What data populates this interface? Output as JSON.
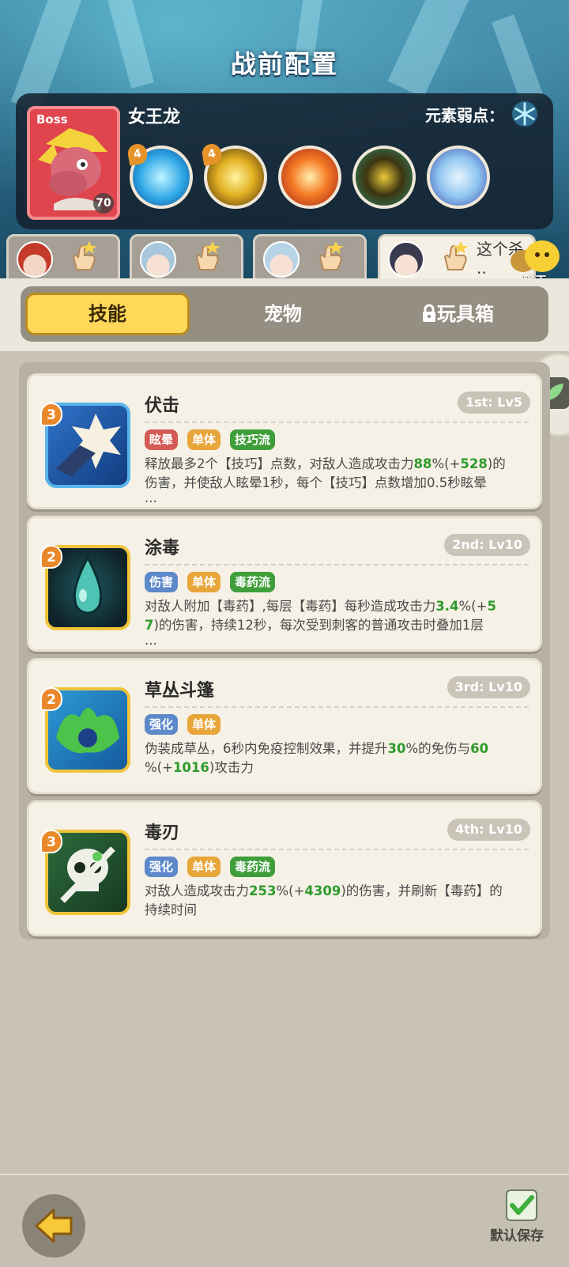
{
  "header": {
    "title": "战前配置"
  },
  "boss": {
    "tag": "Boss",
    "name": "女王龙",
    "level": "70",
    "weakness_label": "元素弱点：",
    "weakness_icon": "snowflake-icon",
    "skills": [
      {
        "icon": "ice-burst-icon",
        "badge": "4"
      },
      {
        "icon": "thunder-crack-icon",
        "badge": "4"
      },
      {
        "icon": "fire-explosion-icon",
        "badge": ""
      },
      {
        "icon": "dark-spirit-icon",
        "badge": ""
      },
      {
        "icon": "ice-crystal-icon",
        "badge": ""
      }
    ]
  },
  "heroes": [
    {
      "avatar": "red-hair-hero-avatar"
    },
    {
      "avatar": "silver-hair-hero-avatar"
    },
    {
      "avatar": "silver-hair-hero-avatar-2"
    },
    {
      "avatar": "dark-hair-hero-avatar",
      "text_line1": "这个杀",
      "text_line2": ".."
    }
  ],
  "chat": {
    "label": "聊天"
  },
  "categories": {
    "skill": "技能",
    "pet": "宠物",
    "toybox": "玩具箱"
  },
  "skills": [
    {
      "name": "伏击",
      "level": "1st: Lv5",
      "badge": "3",
      "tags": [
        "眩晕",
        "单体",
        "技巧流"
      ],
      "desc_line1_a": "释放最多2个【技巧】点数，对敌人造成攻击力",
      "desc_line1_v1": "88",
      "desc_line1_b": "%(+",
      "desc_line1_v2": "528",
      "desc_line1_c": ")的",
      "desc_line2": "伤害，并使敌人眩晕1秒，每个【技巧】点数增加0.5秒眩晕",
      "desc_line3": "..."
    },
    {
      "name": "涂毒",
      "level": "2nd: Lv10",
      "badge": "2",
      "tags": [
        "伤害",
        "单体",
        "毒药流"
      ],
      "desc_line1_a": "对敌人附加【毒药】,每层【毒药】每秒造成攻击力",
      "desc_line1_v1": "3.4",
      "desc_line1_b": "%(+",
      "desc_line1_v2": "5",
      "desc_line2_v": "7",
      "desc_line2": ")的伤害，持续12秒，每次受到刺客的普通攻击时叠加1层",
      "desc_line3": "..."
    },
    {
      "name": "草丛斗篷",
      "level": "3rd: Lv10",
      "badge": "2",
      "tags": [
        "强化",
        "单体"
      ],
      "desc_line1_a": "伪装成草丛，6秒内免疫控制效果，并提升",
      "desc_line1_v1": "30",
      "desc_line1_b": "%的免伤与",
      "desc_line1_v2": "60",
      "desc_line2_a": "%(+",
      "desc_line2_v": "1016",
      "desc_line2_b": ")攻击力"
    },
    {
      "name": "毒刃",
      "level": "4th: Lv10",
      "badge": "3",
      "tags": [
        "强化",
        "单体",
        "毒药流"
      ],
      "desc_line1_a": "对敌人造成攻击力",
      "desc_line1_v1": "253",
      "desc_line1_b": "%(+",
      "desc_line1_v2": "4309",
      "desc_line1_c": ")的伤害，并刷新【毒药】的",
      "desc_line2": "持续时间"
    }
  ],
  "bottom": {
    "save_label": "默认保存"
  },
  "colors": {
    "accent": "#ffd85a",
    "highlight": "#2f9a2c",
    "panel": "#f6f1e6"
  }
}
